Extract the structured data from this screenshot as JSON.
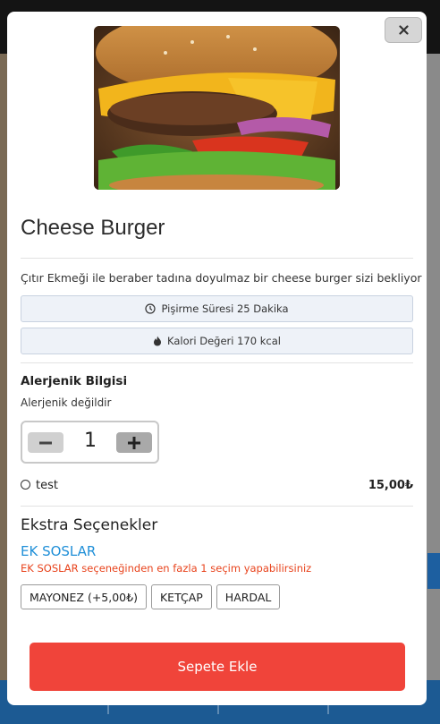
{
  "product": {
    "title": "Cheese Burger",
    "description": "Çıtır Ekmeği ile beraber tadına doyulmaz bir cheese burger sizi bekliyor",
    "cook_time": "Pişirme Süresi 25 Dakika",
    "calories": "Kalori Değeri 170 kcal",
    "image_icon": "burger-photo"
  },
  "allergen": {
    "title": "Alerjenik Bilgisi",
    "text": "Alerjenik değildir"
  },
  "quantity": {
    "value": "1"
  },
  "option": {
    "label": "test",
    "price": "15,00₺"
  },
  "extras": {
    "title": "Ekstra Seçenekler",
    "group_title": "EK SOSLAR",
    "group_note": "EK SOSLAR seçeneğinden en fazla 1 seçim yapabilirsiniz",
    "items": [
      {
        "label": "MAYONEZ (+5,00₺)"
      },
      {
        "label": "KETÇAP"
      },
      {
        "label": "HARDAL"
      }
    ]
  },
  "actions": {
    "add_to_cart": "Sepete Ekle",
    "close": "×"
  },
  "colors": {
    "accent_red": "#f0443a",
    "link_blue": "#1f8fd8",
    "note_orange": "#e8431c",
    "nav_blue": "#1c5a93"
  }
}
